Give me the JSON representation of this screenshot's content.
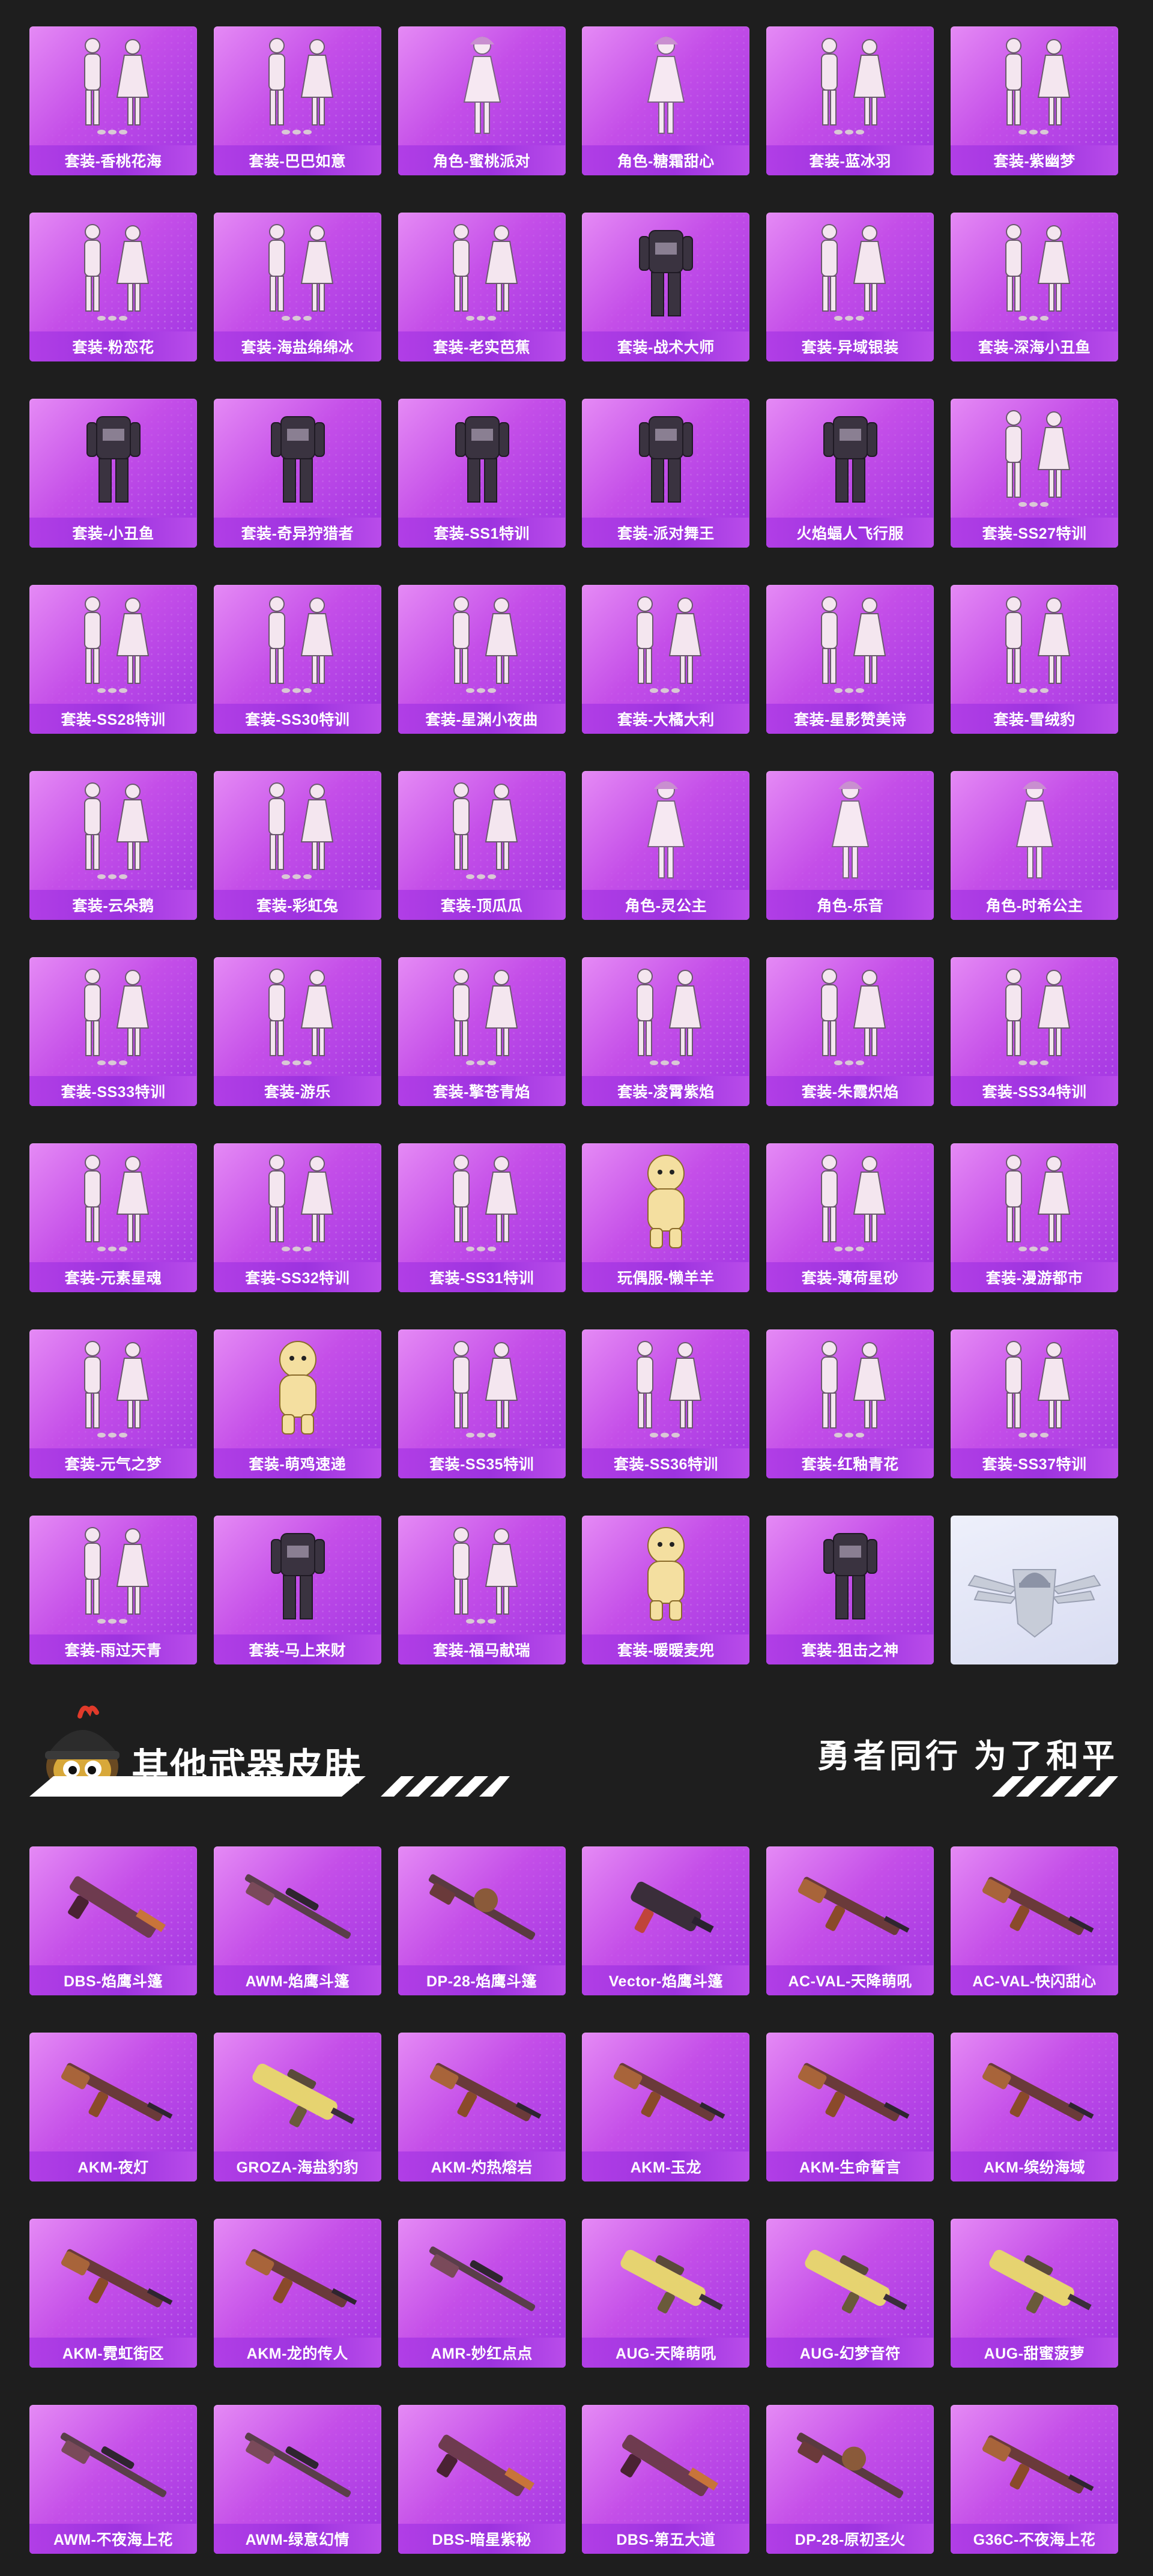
{
  "outfit_cards": [
    {
      "label": "套装-香桃花海",
      "icon": "outfit-pair-icon"
    },
    {
      "label": "套装-巴巴如意",
      "icon": "outfit-pair-icon"
    },
    {
      "label": "角色-蜜桃派对",
      "icon": "character-icon"
    },
    {
      "label": "角色-糖霜甜心",
      "icon": "character-icon"
    },
    {
      "label": "套装-蓝冰羽",
      "icon": "outfit-pair-icon"
    },
    {
      "label": "套装-紫幽梦",
      "icon": "outfit-pair-icon"
    },
    {
      "label": "套装-粉恋花",
      "icon": "outfit-pair-icon"
    },
    {
      "label": "套装-海盐绵绵冰",
      "icon": "outfit-pair-icon"
    },
    {
      "label": "套装-老实芭蕉",
      "icon": "outfit-pair-icon"
    },
    {
      "label": "套装-战术大师",
      "icon": "outfit-single-icon"
    },
    {
      "label": "套装-异域银装",
      "icon": "outfit-pair-icon"
    },
    {
      "label": "套装-深海小丑鱼",
      "icon": "outfit-pair-icon"
    },
    {
      "label": "套装-小丑鱼",
      "icon": "outfit-single-icon"
    },
    {
      "label": "套装-奇异狩猎者",
      "icon": "outfit-single-icon"
    },
    {
      "label": "套装-SS1特训",
      "icon": "outfit-single-icon"
    },
    {
      "label": "套装-派对舞王",
      "icon": "outfit-single-icon"
    },
    {
      "label": "火焰蝠人飞行服",
      "icon": "outfit-single-icon"
    },
    {
      "label": "套装-SS27特训",
      "icon": "outfit-pair-icon"
    },
    {
      "label": "套装-SS28特训",
      "icon": "outfit-pair-icon"
    },
    {
      "label": "套装-SS30特训",
      "icon": "outfit-pair-icon"
    },
    {
      "label": "套装-星渊小夜曲",
      "icon": "outfit-pair-icon"
    },
    {
      "label": "套装-大橘大利",
      "icon": "outfit-pair-icon"
    },
    {
      "label": "套装-星影赞美诗",
      "icon": "outfit-pair-icon"
    },
    {
      "label": "套装-雪绒豹",
      "icon": "outfit-pair-icon"
    },
    {
      "label": "套装-云朵鹅",
      "icon": "outfit-pair-icon"
    },
    {
      "label": "套装-彩虹兔",
      "icon": "outfit-pair-icon"
    },
    {
      "label": "套装-顶瓜瓜",
      "icon": "outfit-pair-icon"
    },
    {
      "label": "角色-灵公主",
      "icon": "character-icon"
    },
    {
      "label": "角色-乐音",
      "icon": "character-icon"
    },
    {
      "label": "角色-时希公主",
      "icon": "character-icon"
    },
    {
      "label": "套装-SS33特训",
      "icon": "outfit-pair-icon"
    },
    {
      "label": "套装-游乐",
      "icon": "outfit-pair-icon"
    },
    {
      "label": "套装-擎苍青焰",
      "icon": "outfit-pair-icon"
    },
    {
      "label": "套装-凌霄紫焰",
      "icon": "outfit-pair-icon"
    },
    {
      "label": "套装-朱霞炽焰",
      "icon": "outfit-pair-icon"
    },
    {
      "label": "套装-SS34特训",
      "icon": "outfit-pair-icon"
    },
    {
      "label": "套装-元素星魂",
      "icon": "outfit-pair-icon"
    },
    {
      "label": "套装-SS32特训",
      "icon": "outfit-pair-icon"
    },
    {
      "label": "套装-SS31特训",
      "icon": "outfit-pair-icon"
    },
    {
      "label": "玩偶服-懒羊羊",
      "icon": "mascot-suit-icon"
    },
    {
      "label": "套装-薄荷星砂",
      "icon": "outfit-pair-icon"
    },
    {
      "label": "套装-漫游都市",
      "icon": "outfit-pair-icon"
    },
    {
      "label": "套装-元气之梦",
      "icon": "outfit-pair-icon"
    },
    {
      "label": "套装-萌鸡速递",
      "icon": "mascot-suit-icon"
    },
    {
      "label": "套装-SS35特训",
      "icon": "outfit-pair-icon"
    },
    {
      "label": "套装-SS36特训",
      "icon": "outfit-pair-icon"
    },
    {
      "label": "套装-红釉青花",
      "icon": "outfit-pair-icon"
    },
    {
      "label": "套装-SS37特训",
      "icon": "outfit-pair-icon"
    },
    {
      "label": "套装-雨过天青",
      "icon": "outfit-pair-icon"
    },
    {
      "label": "套装-马上来财",
      "icon": "outfit-single-icon"
    },
    {
      "label": "套装-福马献瑞",
      "icon": "outfit-pair-icon"
    },
    {
      "label": "套装-暖暖麦兜",
      "icon": "mascot-suit-icon"
    },
    {
      "label": "套装-狙击之神",
      "icon": "outfit-single-icon"
    },
    {
      "label": "",
      "icon": "helmet-wings-emblem-icon",
      "placeholder": true
    }
  ],
  "section": {
    "title": "其他武器皮肤",
    "slogan": "勇者同行 为了和平",
    "mascot_icon": "chicken-helmet-mascot-icon"
  },
  "weapon_cards": [
    {
      "label": "DBS-焰鹰斗篷",
      "icon": "shotgun-icon"
    },
    {
      "label": "AWM-焰鹰斗篷",
      "icon": "sniper-rifle-icon"
    },
    {
      "label": "DP-28-焰鹰斗篷",
      "icon": "machine-gun-icon"
    },
    {
      "label": "Vector-焰鹰斗篷",
      "icon": "smg-icon"
    },
    {
      "label": "AC-VAL-天降萌吼",
      "icon": "assault-rifle-icon"
    },
    {
      "label": "AC-VAL-快闪甜心",
      "icon": "assault-rifle-icon"
    },
    {
      "label": "AKM-夜灯",
      "icon": "assault-rifle-icon"
    },
    {
      "label": "GROZA-海盐豹豹",
      "icon": "bullpup-rifle-icon"
    },
    {
      "label": "AKM-灼热熔岩",
      "icon": "assault-rifle-icon"
    },
    {
      "label": "AKM-玉龙",
      "icon": "assault-rifle-icon"
    },
    {
      "label": "AKM-生命誓言",
      "icon": "assault-rifle-icon"
    },
    {
      "label": "AKM-缤纷海域",
      "icon": "assault-rifle-icon"
    },
    {
      "label": "AKM-霓虹街区",
      "icon": "assault-rifle-icon"
    },
    {
      "label": "AKM-龙的传人",
      "icon": "assault-rifle-icon"
    },
    {
      "label": "AMR-妙红点点",
      "icon": "sniper-rifle-icon"
    },
    {
      "label": "AUG-天降萌吼",
      "icon": "bullpup-rifle-icon"
    },
    {
      "label": "AUG-幻梦音符",
      "icon": "bullpup-rifle-icon"
    },
    {
      "label": "AUG-甜蜜菠萝",
      "icon": "bullpup-rifle-icon"
    },
    {
      "label": "AWM-不夜海上花",
      "icon": "sniper-rifle-icon"
    },
    {
      "label": "AWM-绿意幻情",
      "icon": "sniper-rifle-icon"
    },
    {
      "label": "DBS-暗星紫秘",
      "icon": "shotgun-icon"
    },
    {
      "label": "DBS-第五大道",
      "icon": "shotgun-icon"
    },
    {
      "label": "DP-28-原初圣火",
      "icon": "machine-gun-icon"
    },
    {
      "label": "G36C-不夜海上花",
      "icon": "assault-rifle-icon"
    }
  ],
  "colors": {
    "page_background": "#1e1e1e",
    "card_gradient_start": "#e58af5",
    "card_gradient_end": "#9f35e2",
    "label_bar": "#a536e2",
    "placeholder_card": "#e4e7f6"
  }
}
